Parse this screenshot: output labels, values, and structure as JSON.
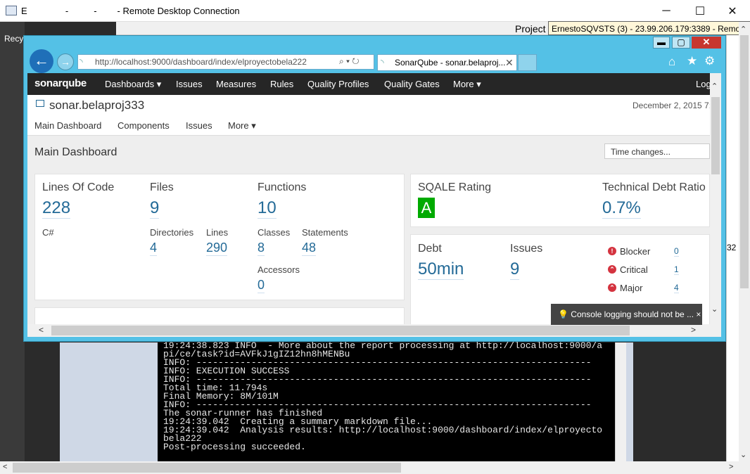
{
  "rdp": {
    "title": "E               -          -        - Remote Desktop Connection",
    "tooltip": "ErnestoSQVSTS (3) - 23.99.206.179:3389 - Remote Desktop",
    "minimize": "─",
    "maximize": "☐",
    "close": "✕"
  },
  "desktop": {
    "recycle_label": "Recy",
    "project_label": "Project",
    "right_fragment": "32"
  },
  "console": {
    "lines": "19:24:38.823 INFO  - More about the report processing at http://localhost:9000/a\npi/ce/task?id=AVFkJ1gIZ12hn8hMENBu\nINFO: ------------------------------------------------------------------------\nINFO: EXECUTION SUCCESS\nINFO: ------------------------------------------------------------------------\nTotal time: 11.794s\nFinal Memory: 8M/101M\nINFO: ------------------------------------------------------------------------\nThe sonar-runner has finished\n19:24:39.042  Creating a summary markdown file...\n19:24:39.042  Analysis results: http://localhost:9000/dashboard/index/elproyecto\nbela222\nPost-processing succeeded."
  },
  "browser": {
    "url": "http://localhost:9000/dashboard/index/elproyectobela222",
    "tab_title": "SonarQube - sonar.belaproj...",
    "back": "←",
    "forward": "→",
    "addr_tools": "⌕ ▾ ↻",
    "tab_close": "✕",
    "home": "⌂",
    "star": "★",
    "gear": "⚙",
    "win_min": "▬",
    "win_max": "▢",
    "win_close": "✕"
  },
  "nav": {
    "logo": "sonarqube",
    "items": [
      "Dashboards ▾",
      "Issues",
      "Measures",
      "Rules",
      "Quality Profiles",
      "Quality Gates",
      "More ▾"
    ],
    "login": "Log"
  },
  "project": {
    "name": "sonar.belaproj333",
    "date": "December 2, 2015 7:",
    "tabs": [
      "Main Dashboard",
      "Components",
      "Issues",
      "More ▾"
    ]
  },
  "dashboard": {
    "title": "Main Dashboard",
    "time_select": "Time changes..."
  },
  "size": {
    "loc_label": "Lines Of Code",
    "loc": "228",
    "files_label": "Files",
    "files": "9",
    "functions_label": "Functions",
    "functions": "10",
    "language": "C#",
    "directories_label": "Directories",
    "directories": "4",
    "lines_label": "Lines",
    "lines": "290",
    "classes_label": "Classes",
    "classes": "8",
    "statements_label": "Statements",
    "statements": "48",
    "accessors_label": "Accessors",
    "accessors": "0"
  },
  "sqale": {
    "rating_label": "SQALE Rating",
    "rating": "A",
    "tdr_label": "Technical Debt Ratio",
    "tdr": "0.7%"
  },
  "debt": {
    "debt_label": "Debt",
    "debt": "50min",
    "issues_label": "Issues",
    "issues": "9",
    "severities": [
      {
        "label": "Blocker",
        "value": "0",
        "icon": "!"
      },
      {
        "label": "Critical",
        "value": "1",
        "icon": "⌃"
      },
      {
        "label": "Major",
        "value": "4",
        "icon": "⌃"
      }
    ]
  },
  "toast": {
    "text": "💡 Console logging should not be ...  ×"
  },
  "scroll": {
    "up": "⌃",
    "down": "⌄",
    "left": "<",
    "right": ">"
  },
  "colors": {
    "accent": "#236a97",
    "rating_a": "#00aa00",
    "ie_frame": "#54c1e6",
    "nav_bg": "#262626"
  }
}
